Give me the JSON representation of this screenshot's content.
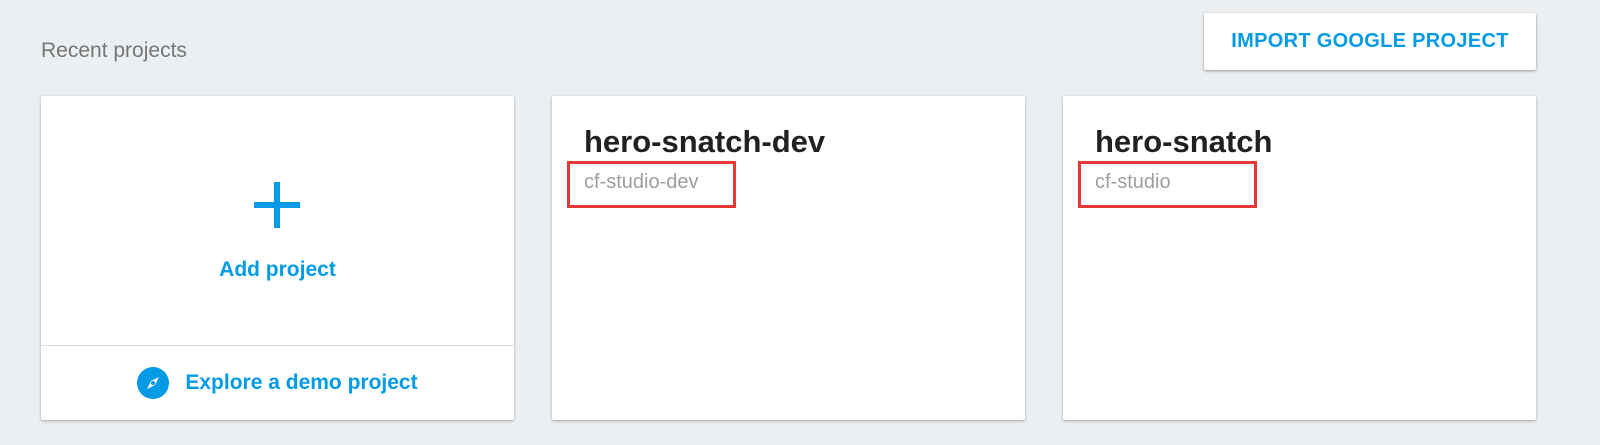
{
  "header": {
    "section_title": "Recent projects",
    "import_button_label": "IMPORT GOOGLE PROJECT"
  },
  "add_card": {
    "add_label": "Add project",
    "demo_label": "Explore a demo project",
    "plus_icon": "plus-icon",
    "demo_icon": "compass-icon"
  },
  "projects": [
    {
      "name": "hero-snatch-dev",
      "id": "cf-studio-dev"
    },
    {
      "name": "hero-snatch",
      "id": "cf-studio"
    }
  ],
  "colors": {
    "background": "#eceff1",
    "accent": "#039be5",
    "title_text": "#212121",
    "id_text": "#9e9e9e",
    "highlight": "#e53935"
  }
}
